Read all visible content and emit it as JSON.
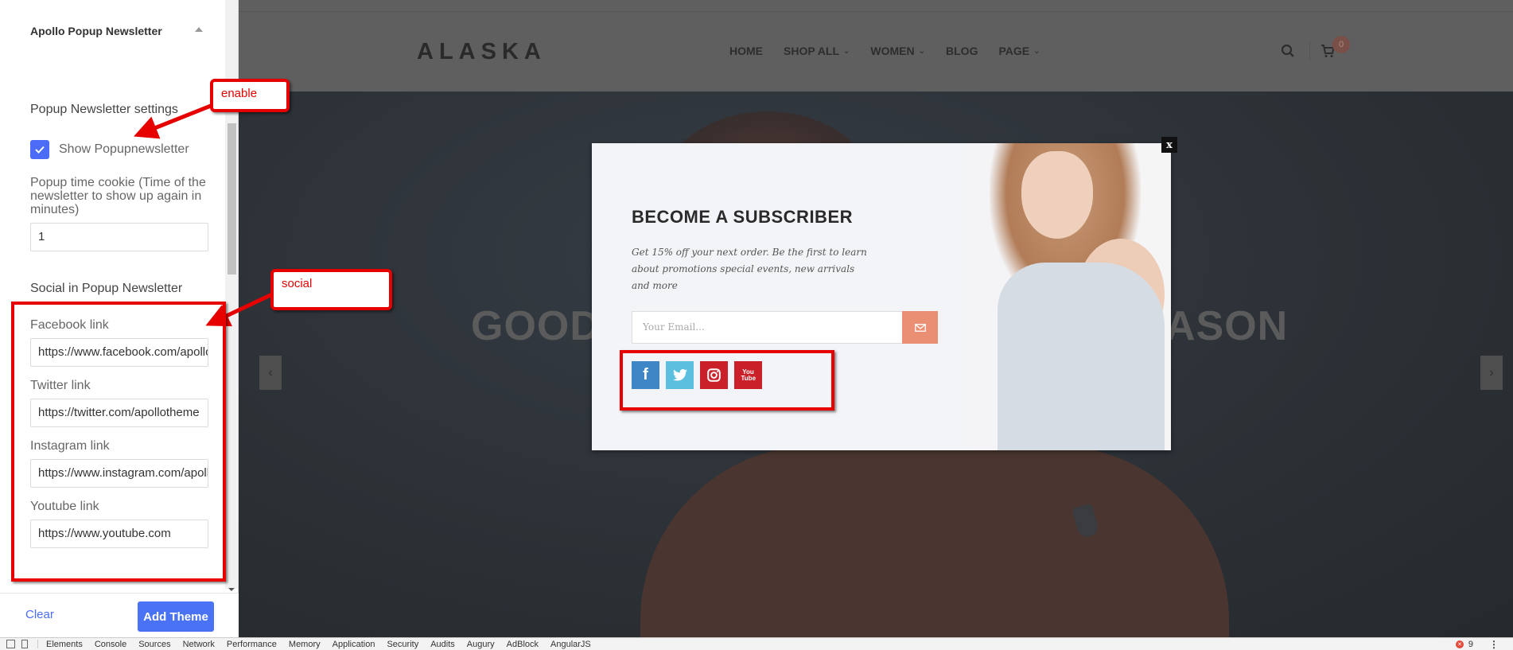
{
  "sidebar": {
    "title": "Apollo Popup Newsletter",
    "section_settings": "Popup Newsletter settings",
    "show_popup": {
      "label": "Show Popupnewsletter",
      "checked": true
    },
    "cookie_label": "Popup time cookie (Time of the newsletter to show up again in minutes)",
    "cookie_value": "1",
    "section_social": "Social in Popup Newsletter",
    "social_fields": [
      {
        "label": "Facebook link",
        "value": "https://www.facebook.com/apollotheme"
      },
      {
        "label": "Twitter link",
        "value": "https://twitter.com/apollotheme"
      },
      {
        "label": "Instagram link",
        "value": "https://www.instagram.com/apollotheme"
      },
      {
        "label": "Youtube link",
        "value": "https://www.youtube.com"
      }
    ],
    "clear_label": "Clear",
    "add_label": "Add Theme"
  },
  "store": {
    "logo": "ALASKA",
    "nav": [
      {
        "label": "HOME",
        "has_dropdown": false
      },
      {
        "label": "SHOP ALL",
        "has_dropdown": true
      },
      {
        "label": "WOMEN",
        "has_dropdown": true
      },
      {
        "label": "BLOG",
        "has_dropdown": false
      },
      {
        "label": "PAGE",
        "has_dropdown": true
      }
    ],
    "cart_count": "0",
    "hero_text_left": "GOOD",
    "hero_text_right": "ASON",
    "prev_label": "‹",
    "next_label": "›"
  },
  "popup": {
    "close_label": "x",
    "title": "BECOME A SUBSCRIBER",
    "description": "Get 15% off your next order. Be the first to learn about promotions special events, new arrivals and more",
    "email_placeholder": "Your Email...",
    "socials": [
      {
        "name": "facebook",
        "glyph": "f",
        "color": "#3e86c6"
      },
      {
        "name": "twitter",
        "glyph": "",
        "color": "#5bbfe0"
      },
      {
        "name": "instagram",
        "glyph": "",
        "color": "#c9202a"
      },
      {
        "name": "youtube",
        "glyph": "You Tube",
        "color": "#c9202a"
      }
    ]
  },
  "annotations": {
    "enable": "enable",
    "social": "social"
  },
  "devtools": {
    "tabs": [
      "Elements",
      "Console",
      "Sources",
      "Network",
      "Performance",
      "Memory",
      "Application",
      "Security",
      "Audits",
      "Augury",
      "AdBlock",
      "AngularJS"
    ],
    "error_count": "9"
  },
  "colors": {
    "accent": "#4a6cf7",
    "annotation": "#e60000",
    "send_button": "#ea8e74"
  }
}
